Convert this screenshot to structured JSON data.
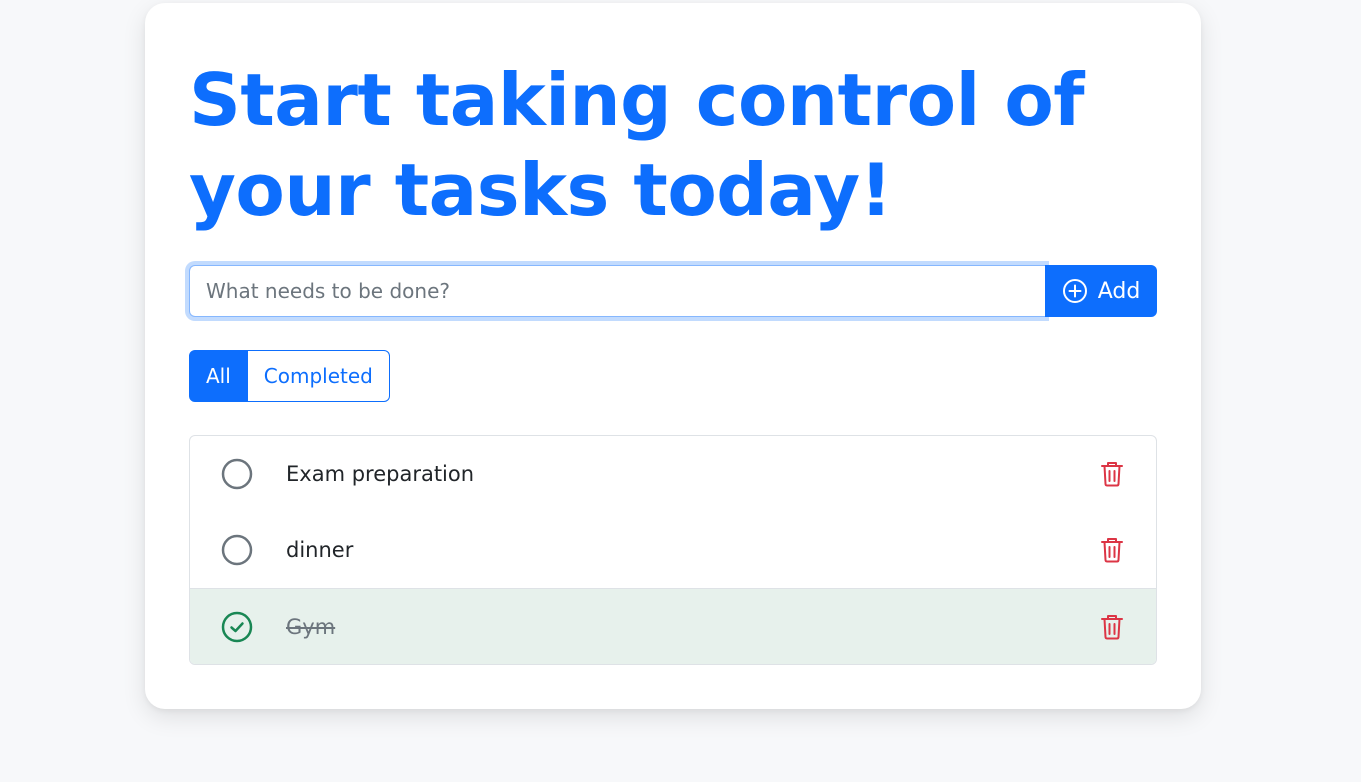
{
  "header": {
    "title": "Start taking control of your tasks today!"
  },
  "add_form": {
    "placeholder": "What needs to be done?",
    "value": "",
    "add_label": "Add",
    "add_icon": "plus-circle-icon"
  },
  "filters": {
    "all_label": "All",
    "completed_label": "Completed",
    "active": "All"
  },
  "tasks": [
    {
      "text": "Exam preparation",
      "completed": false
    },
    {
      "text": "dinner",
      "completed": false
    },
    {
      "text": "Gym",
      "completed": true
    }
  ],
  "colors": {
    "primary": "#0d6efd",
    "danger": "#dc3545",
    "success": "#198754",
    "completed_bg": "#e7f1ec"
  }
}
